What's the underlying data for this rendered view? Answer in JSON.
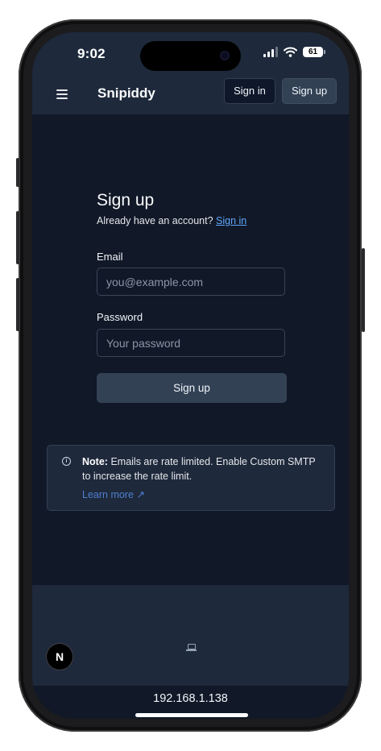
{
  "status_bar": {
    "time": "9:02",
    "battery": "61"
  },
  "header": {
    "brand": "Snipiddy",
    "sign_in_label": "Sign in",
    "sign_up_label": "Sign up"
  },
  "form": {
    "title": "Sign up",
    "subtitle": "Already have an account?",
    "subtitle_link": "Sign in",
    "email_label": "Email",
    "email_placeholder": "you@example.com",
    "password_label": "Password",
    "password_placeholder": "Your password",
    "submit_label": "Sign up"
  },
  "note": {
    "heading": "Note:",
    "body": "Emails are rate limited. Enable Custom SMTP to increase the rate limit.",
    "link": "Learn more ↗"
  },
  "footer": {
    "badge": "N"
  },
  "browser": {
    "url": "192.168.1.138"
  },
  "colors": {
    "background": "#111827",
    "header": "#1e293b",
    "button": "#334155",
    "link": "#60a5fa"
  }
}
